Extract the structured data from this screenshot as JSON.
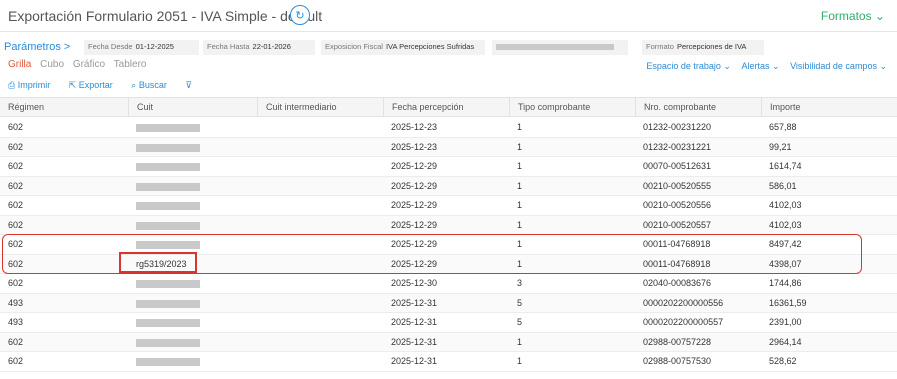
{
  "header": {
    "title": "Exportación Formulario 2051 - IVA Simple - default",
    "formatos": "Formatos ⌄"
  },
  "params": {
    "link": "Parámetros >",
    "fecha_desde_label": "Fecha Desde",
    "fecha_desde": "01-12-2025",
    "fecha_hasta_label": "Fecha Hasta",
    "fecha_hasta": "22-01-2026",
    "exposicion_label": "Exposicion Fiscal",
    "exposicion": "IVA Percepciones Sufridas",
    "formato_label": "Formato",
    "formato": "Percepciones de IVA"
  },
  "views": [
    "Grilla",
    "Cubo",
    "Gráfico",
    "Tablero"
  ],
  "right_links": [
    "Espacio de trabajo ⌄",
    "Alertas ⌄",
    "Visibilidad de campos ⌄"
  ],
  "toolbar": [
    "Imprimir",
    "Exportar",
    "Buscar"
  ],
  "columns": [
    "Régimen",
    "Cuit",
    "Cuit intermediario",
    "Fecha percepción",
    "Tipo comprobante",
    "Nro. comprobante",
    "Importe"
  ],
  "rows": [
    [
      "602",
      "",
      "",
      "2025-12-23",
      "1",
      "01232-00231220",
      "657,88"
    ],
    [
      "602",
      "",
      "",
      "2025-12-23",
      "1",
      "01232-00231221",
      "99,21"
    ],
    [
      "602",
      "",
      "",
      "2025-12-29",
      "1",
      "00070-00512631",
      "1614,74"
    ],
    [
      "602",
      "",
      "",
      "2025-12-29",
      "1",
      "00210-00520555",
      "586,01"
    ],
    [
      "602",
      "",
      "",
      "2025-12-29",
      "1",
      "00210-00520556",
      "4102,03"
    ],
    [
      "602",
      "",
      "",
      "2025-12-29",
      "1",
      "00210-00520557",
      "4102,03"
    ],
    [
      "602",
      "",
      "",
      "2025-12-29",
      "1",
      "00011-04768918",
      "8497,42"
    ],
    [
      "602",
      "rg5319/2023",
      "",
      "2025-12-29",
      "1",
      "00011-04768918",
      "4398,07"
    ],
    [
      "602",
      "",
      "",
      "2025-12-30",
      "3",
      "02040-00083676",
      "1744,86"
    ],
    [
      "493",
      "",
      "",
      "2025-12-31",
      "5",
      "0000202200000556",
      "16361,59"
    ],
    [
      "493",
      "",
      "",
      "2025-12-31",
      "5",
      "0000202200000557",
      "2391,00"
    ],
    [
      "602",
      "",
      "",
      "2025-12-31",
      "1",
      "02988-00757228",
      "2964,14"
    ],
    [
      "602",
      "",
      "",
      "2025-12-31",
      "1",
      "02988-00757530",
      "528,62"
    ]
  ]
}
